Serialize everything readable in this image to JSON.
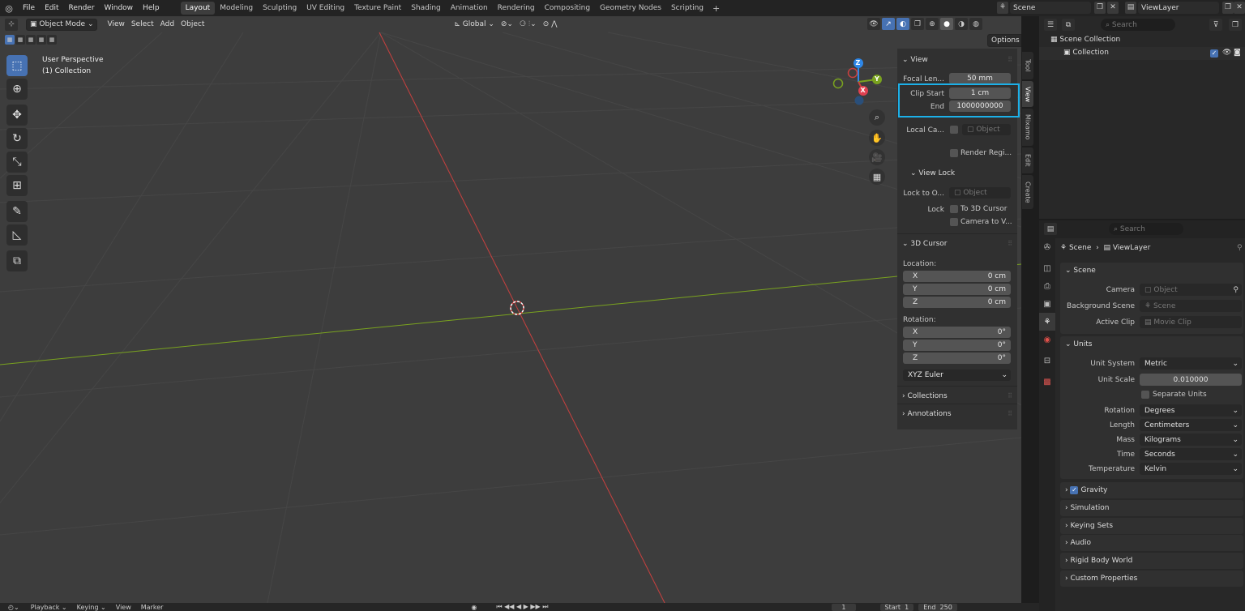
{
  "topbar": {
    "menus": [
      "File",
      "Edit",
      "Render",
      "Window",
      "Help"
    ],
    "workspaces": [
      "Layout",
      "Modeling",
      "Sculpting",
      "UV Editing",
      "Texture Paint",
      "Shading",
      "Animation",
      "Rendering",
      "Compositing",
      "Geometry Nodes",
      "Scripting"
    ],
    "active_workspace": "Layout",
    "scene_name": "Scene",
    "view_layer_name": "ViewLayer"
  },
  "viewport_header": {
    "mode": "Object Mode",
    "menus": [
      "View",
      "Select",
      "Add",
      "Object"
    ],
    "orientation": "Global",
    "options_label": "Options"
  },
  "viewport": {
    "perspective_label": "User Perspective",
    "collection_label": "(1) Collection",
    "gizmo": {
      "x": "X",
      "y": "Y",
      "z": "Z"
    }
  },
  "npanel": {
    "view_header": "View",
    "focal_length_label": "Focal Len...",
    "focal_length_value": "50 mm",
    "clip_start_label": "Clip Start",
    "clip_start_value": "1 cm",
    "clip_end_label": "End",
    "clip_end_value": "1000000000",
    "local_camera_label": "Local Ca...",
    "local_camera_placeholder": "Object",
    "render_region_label": "Render Regi...",
    "view_lock_header": "View Lock",
    "lock_to_object_label": "Lock to O...",
    "lock_to_object_placeholder": "Object",
    "lock_label": "Lock",
    "to_3d_cursor_label": "To 3D Cursor",
    "camera_to_view_label": "Camera to V...",
    "cursor_header": "3D Cursor",
    "location_label": "Location:",
    "location": [
      {
        "axis": "X",
        "value": "0 cm"
      },
      {
        "axis": "Y",
        "value": "0 cm"
      },
      {
        "axis": "Z",
        "value": "0 cm"
      }
    ],
    "rotation_label": "Rotation:",
    "rotation": [
      {
        "axis": "X",
        "value": "0°"
      },
      {
        "axis": "Y",
        "value": "0°"
      },
      {
        "axis": "Z",
        "value": "0°"
      }
    ],
    "rotation_mode": "XYZ Euler",
    "collections_header": "Collections",
    "annotations_header": "Annotations",
    "tabs": [
      "Tool",
      "View",
      "Mixamo",
      "Edit",
      "Create"
    ],
    "active_tab": "View"
  },
  "outliner": {
    "search_placeholder": "Search",
    "scene_collection": "Scene Collection",
    "collection": "Collection"
  },
  "properties": {
    "search_placeholder": "Search",
    "breadcrumb_scene": "Scene",
    "breadcrumb_view_layer": "ViewLayer",
    "scene_header": "Scene",
    "camera_label": "Camera",
    "camera_placeholder": "Object",
    "background_scene_label": "Background Scene",
    "background_scene_placeholder": "Scene",
    "active_clip_label": "Active Clip",
    "active_clip_placeholder": "Movie Clip",
    "units_header": "Units",
    "unit_system_label": "Unit System",
    "unit_system_value": "Metric",
    "unit_scale_label": "Unit Scale",
    "unit_scale_value": "0.010000",
    "separate_units_label": "Separate Units",
    "rotation_label": "Rotation",
    "rotation_value": "Degrees",
    "length_label": "Length",
    "length_value": "Centimeters",
    "mass_label": "Mass",
    "mass_value": "Kilograms",
    "time_label": "Time",
    "time_value": "Seconds",
    "temperature_label": "Temperature",
    "temperature_value": "Kelvin",
    "gravity_label": "Gravity",
    "simulation_label": "Simulation",
    "keying_sets_label": "Keying Sets",
    "audio_label": "Audio",
    "rigid_body_world_label": "Rigid Body World",
    "custom_properties_label": "Custom Properties"
  },
  "timeline": {
    "playback": "Playback",
    "keying": "Keying",
    "view": "View",
    "marker": "Marker",
    "current_frame": "1",
    "start_label": "Start",
    "start_value": "1",
    "end_label": "End",
    "end_value": "250"
  },
  "colors": {
    "accent": "#4772b3",
    "highlight": "#1cb0e8",
    "x_axis": "#c9403f",
    "y_axis": "#7aa31f",
    "z_axis": "#2e87e8"
  }
}
